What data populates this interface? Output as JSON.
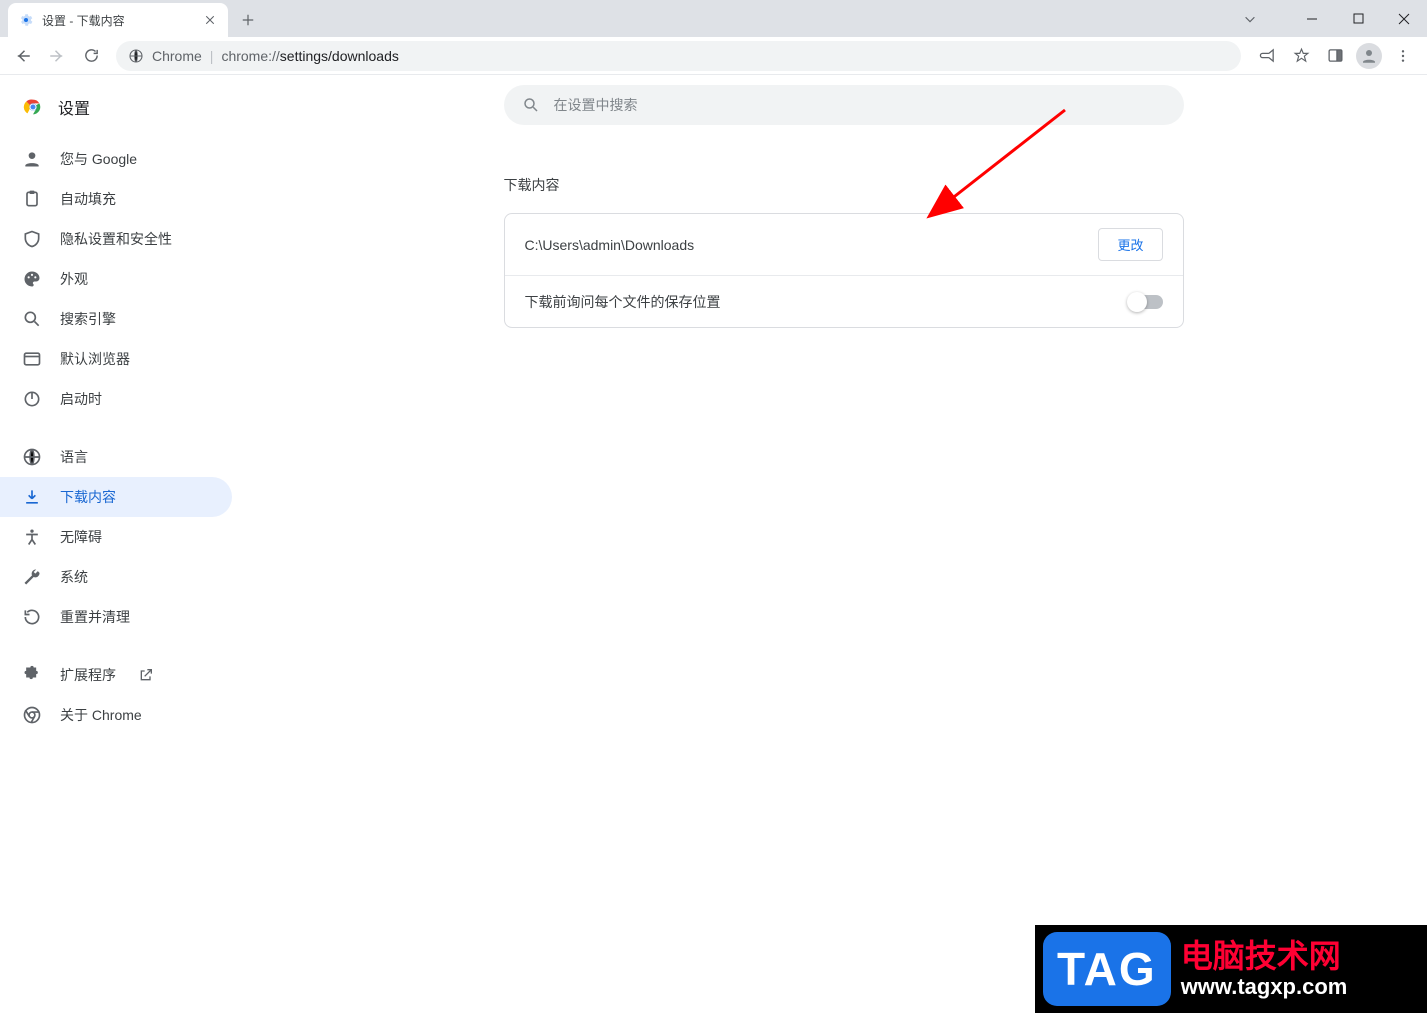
{
  "window": {
    "tab_title": "设置 - 下载内容"
  },
  "addr": {
    "prefix": "Chrome",
    "url_prefix": "chrome://",
    "url_path": "settings/downloads"
  },
  "sidebar": {
    "title": "设置",
    "items": [
      {
        "label": "您与 Google"
      },
      {
        "label": "自动填充"
      },
      {
        "label": "隐私设置和安全性"
      },
      {
        "label": "外观"
      },
      {
        "label": "搜索引擎"
      },
      {
        "label": "默认浏览器"
      },
      {
        "label": "启动时"
      }
    ],
    "items2": [
      {
        "label": "语言"
      },
      {
        "label": "下载内容"
      },
      {
        "label": "无障碍"
      },
      {
        "label": "系统"
      },
      {
        "label": "重置并清理"
      }
    ],
    "items3": [
      {
        "label": "扩展程序"
      },
      {
        "label": "关于 Chrome"
      }
    ]
  },
  "content": {
    "search_placeholder": "在设置中搜索",
    "section_title": "下载内容",
    "download_path": "C:\\Users\\admin\\Downloads",
    "change_btn": "更改",
    "ask_location_label": "下载前询问每个文件的保存位置"
  },
  "watermark": {
    "tag": "TAG",
    "line1": "电脑技术网",
    "line2": "www.tagxp.com"
  }
}
